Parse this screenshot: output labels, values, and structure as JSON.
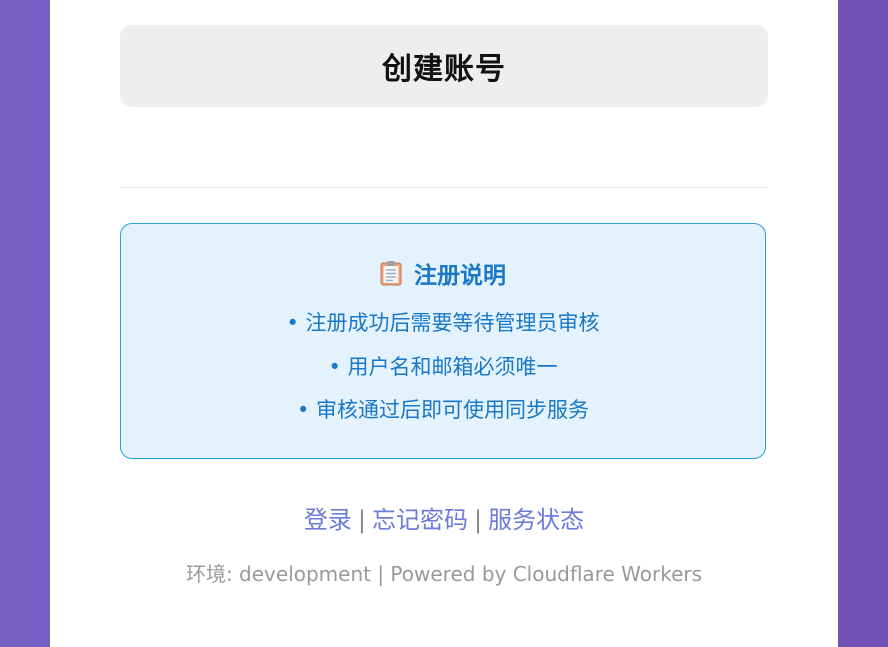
{
  "form": {
    "submit_label": "创建账号"
  },
  "info": {
    "icon": "clipboard-icon",
    "title": "注册说明",
    "items": [
      "• 注册成功后需要等待管理员审核",
      "• 用户名和邮箱必须唯一",
      "• 审核通过后即可使用同步服务"
    ]
  },
  "links": {
    "login": "登录",
    "separator": "|",
    "forgot_password": "忘记密码",
    "service_status": "服务状态"
  },
  "footer": {
    "env_text": "环境: development | Powered by Cloudflare Workers"
  },
  "colors": {
    "background_gradient_start": "#7560c4",
    "background_gradient_end": "#6f52b4",
    "info_text": "#1a78c8",
    "info_background": "#e3f2fc",
    "info_border": "#2aa0dc",
    "link": "#6b7bd8",
    "footer_text": "#999999"
  }
}
